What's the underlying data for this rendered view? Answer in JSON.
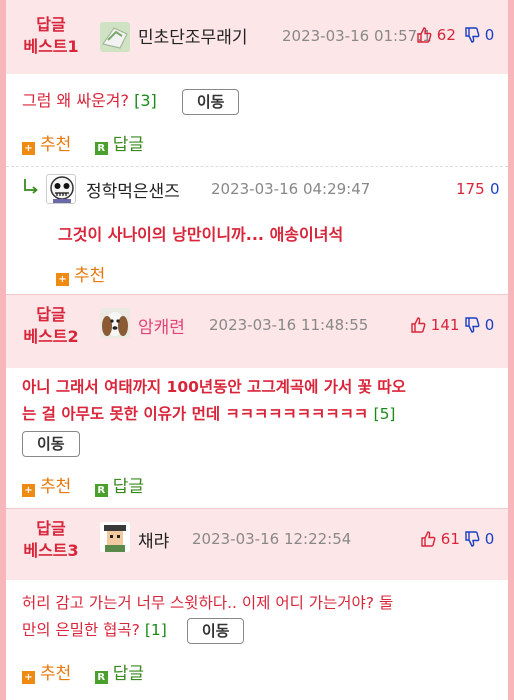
{
  "posts": [
    {
      "best_label": "답글\n베스트1",
      "best_label_l1": "답글",
      "best_label_l2": "베스트1",
      "nickname": "민초단조무래기",
      "time": "2023-03-16 01:57:1",
      "up": "62",
      "down": "0",
      "text": "그럼 왜 싸운겨?",
      "reply_count": "[3]",
      "move_label": "이동",
      "recommend_label": "추천",
      "reply_label": "답글"
    },
    {
      "nickname": "정학먹은샌즈",
      "time": "2023-03-16 04:29:47",
      "up": "175",
      "down": "0",
      "text": "그것이 사나이의 낭만이니까... 애송이녀석",
      "recommend_label": "추천"
    },
    {
      "best_label_l1": "답글",
      "best_label_l2": "베스트2",
      "nickname": "암캐련",
      "time": "2023-03-16 11:48:55",
      "up": "141",
      "down": "0",
      "text_l1": "아니 그래서 여태까지 100년동안 고그계곡에 가서 꽃 따오",
      "text_l2": "는 걸 아무도 못한 이유가 먼데 ㅋㅋㅋㅋㅋㅋㅋㅋㅋㅋ",
      "reply_count": "[5]",
      "move_label": "이동",
      "recommend_label": "추천",
      "reply_label": "답글"
    },
    {
      "best_label_l1": "답글",
      "best_label_l2": "베스트3",
      "nickname": "채랴",
      "time": "2023-03-16 12:22:54",
      "up": "61",
      "down": "0",
      "text_l1": "허리 감고 가는거 너무 스윗하다.. 이제 어디 가는거야? 둘",
      "text_l2": "만의 은밀한 협곡?",
      "reply_count": "[1]",
      "move_label": "이동",
      "recommend_label": "추천",
      "reply_label": "답글"
    }
  ],
  "icons": {
    "thumbs_up": "thumbs-up-icon",
    "thumbs_down": "thumbs-down-icon",
    "reply_arrow": "reply-arrow-icon",
    "plus": "plus-icon",
    "reply_r": "reply-r-icon"
  },
  "colors": {
    "accent_red": "#d9253a",
    "blue": "#1a3fc4",
    "orange": "#e8780a",
    "green": "#3a8a1f",
    "header_bg": "#fde6e8",
    "page_border": "#f7b6ba"
  }
}
